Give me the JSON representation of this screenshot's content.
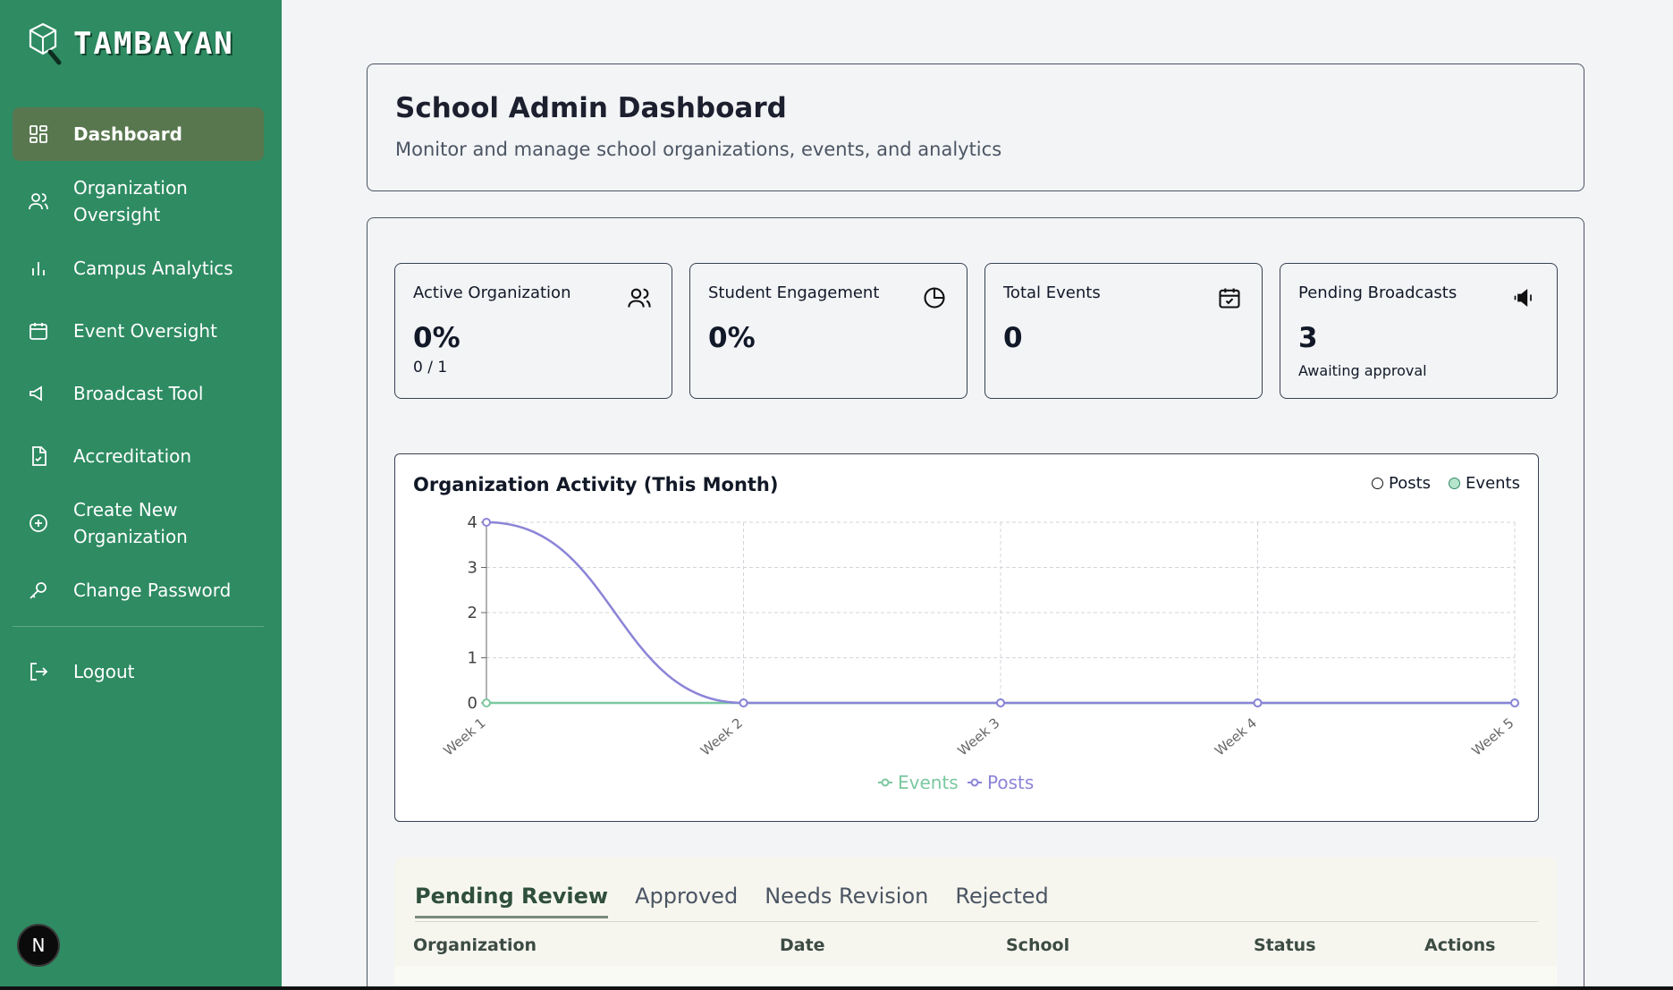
{
  "app": {
    "name": "TAMBAYAN",
    "avatar_initial": "N"
  },
  "sidebar": {
    "items": [
      {
        "label": "Dashboard",
        "icon": "dashboard-icon",
        "active": true
      },
      {
        "label": "Organization Oversight",
        "icon": "users-icon"
      },
      {
        "label": "Campus Analytics",
        "icon": "bar-chart-icon"
      },
      {
        "label": "Event Oversight",
        "icon": "calendar-icon"
      },
      {
        "label": "Broadcast Tool",
        "icon": "megaphone-icon"
      },
      {
        "label": "Accreditation",
        "icon": "file-check-icon"
      },
      {
        "label": "Create New Organization",
        "icon": "plus-circle-icon"
      },
      {
        "label": "Change Password",
        "icon": "key-icon"
      }
    ],
    "logout": {
      "label": "Logout",
      "icon": "logout-icon"
    }
  },
  "header": {
    "title": "School Admin Dashboard",
    "subtitle": "Monitor and manage school organizations, events, and analytics"
  },
  "stats": [
    {
      "label": "Active Organization",
      "value": "0%",
      "sub": "0 / 1",
      "icon": "users-icon"
    },
    {
      "label": "Student Engagement",
      "value": "0%",
      "sub": "",
      "icon": "pie-chart-icon"
    },
    {
      "label": "Total Events",
      "value": "0",
      "sub": "",
      "icon": "calendar-check-icon"
    },
    {
      "label": "Pending Broadcasts",
      "value": "3",
      "sub": "Awaiting approval",
      "icon": "megaphone-icon"
    }
  ],
  "chart": {
    "title": "Organization Activity (This Month)",
    "legend_top": [
      "Posts",
      "Events"
    ]
  },
  "chart_data": {
    "type": "line",
    "title": "Organization Activity (This Month)",
    "x": [
      "Week 1",
      "Week 2",
      "Week 3",
      "Week 4",
      "Week 5"
    ],
    "series": [
      {
        "name": "Events",
        "values": [
          0,
          0,
          0,
          0,
          0
        ],
        "color": "#7bc8a0"
      },
      {
        "name": "Posts",
        "values": [
          4,
          0,
          0,
          0,
          0
        ],
        "color": "#8b84d7"
      }
    ],
    "yticks": [
      0,
      1,
      2,
      3,
      4
    ],
    "ylim": [
      0,
      4
    ],
    "grid": true,
    "legend_bottom": [
      "Events",
      "Posts"
    ]
  },
  "review": {
    "tabs": [
      "Pending Review",
      "Approved",
      "Needs Revision",
      "Rejected"
    ],
    "columns": [
      "Organization",
      "Date",
      "School",
      "Status",
      "Actions"
    ]
  }
}
